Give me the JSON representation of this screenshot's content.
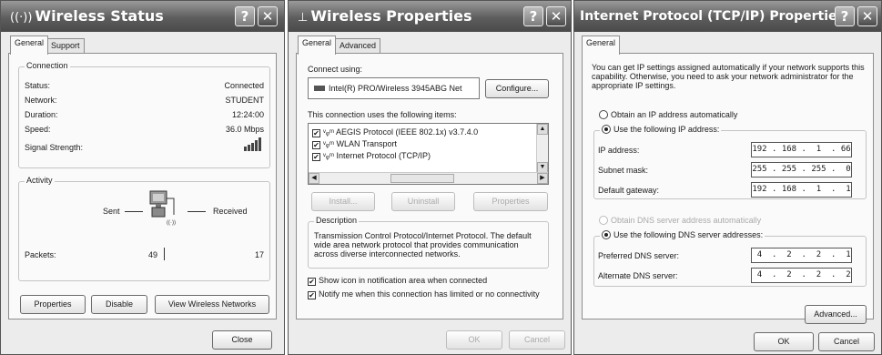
{
  "colors": {
    "titlebar": "#5d5d5d",
    "window_bg": "#ececec",
    "page_bg": "#fafafa"
  },
  "status": {
    "title": "Wireless Status",
    "title_icon": "wireless-icon",
    "tabs": [
      "General",
      "Support"
    ],
    "connection_group": "Connection",
    "rows": [
      {
        "label": "Status:",
        "value": "Connected"
      },
      {
        "label": "Network:",
        "value": "STUDENT"
      },
      {
        "label": "Duration:",
        "value": "12:24:00"
      },
      {
        "label": "Speed:",
        "value": "36.0 Mbps"
      }
    ],
    "signal_label": "Signal Strength:",
    "activity_group": "Activity",
    "sent_label": "Sent",
    "received_label": "Received",
    "packets_label": "Packets:",
    "packets_sent": "49",
    "packets_received": "17",
    "buttons": {
      "properties": "Properties",
      "disable": "Disable",
      "view_networks": "View Wireless Networks",
      "close": "Close"
    }
  },
  "props": {
    "title": "Wireless Properties",
    "tabs": [
      "General",
      "Advanced"
    ],
    "connect_using": "Connect using:",
    "adapter": "Intel(R) PRO/Wireless 3945ABG Net",
    "configure": "Configure...",
    "items_label": "This connection uses the following items:",
    "items": [
      "AEGIS Protocol (IEEE 802.1x) v3.7.4.0",
      "WLAN Transport",
      "Internet Protocol (TCP/IP)"
    ],
    "install": "Install...",
    "uninstall": "Uninstall",
    "properties": "Properties",
    "description_group": "Description",
    "description": "Transmission Control Protocol/Internet Protocol. The default wide area network protocol that provides communication across diverse interconnected networks.",
    "show_icon": "Show icon in notification area when connected",
    "notify": "Notify me when this connection has limited or no connectivity",
    "ok": "OK",
    "cancel": "Cancel"
  },
  "tcpip": {
    "title": "Internet Protocol (TCP/IP) Properties",
    "tab": "General",
    "intro": "You can get IP settings assigned automatically if your network supports this capability. Otherwise, you need to ask your network administrator for the appropriate IP settings.",
    "obtain_ip_auto": "Obtain an IP address automatically",
    "use_ip": "Use the following IP address:",
    "ip_label": "IP address:",
    "ip_value": "192 . 168 .  1  . 66",
    "mask_label": "Subnet mask:",
    "mask_value": "255 . 255 . 255 .  0",
    "gateway_label": "Default gateway:",
    "gateway_value": "192 . 168 .  1  .  1",
    "obtain_dns_auto": "Obtain DNS server address automatically",
    "use_dns": "Use the following DNS server addresses:",
    "pref_dns_label": "Preferred DNS server:",
    "pref_dns_value": " 4  .  2  .  2  .  1",
    "alt_dns_label": "Alternate DNS server:",
    "alt_dns_value": " 4  .  2  .  2  .  2",
    "advanced": "Advanced...",
    "ok": "OK",
    "cancel": "Cancel"
  }
}
